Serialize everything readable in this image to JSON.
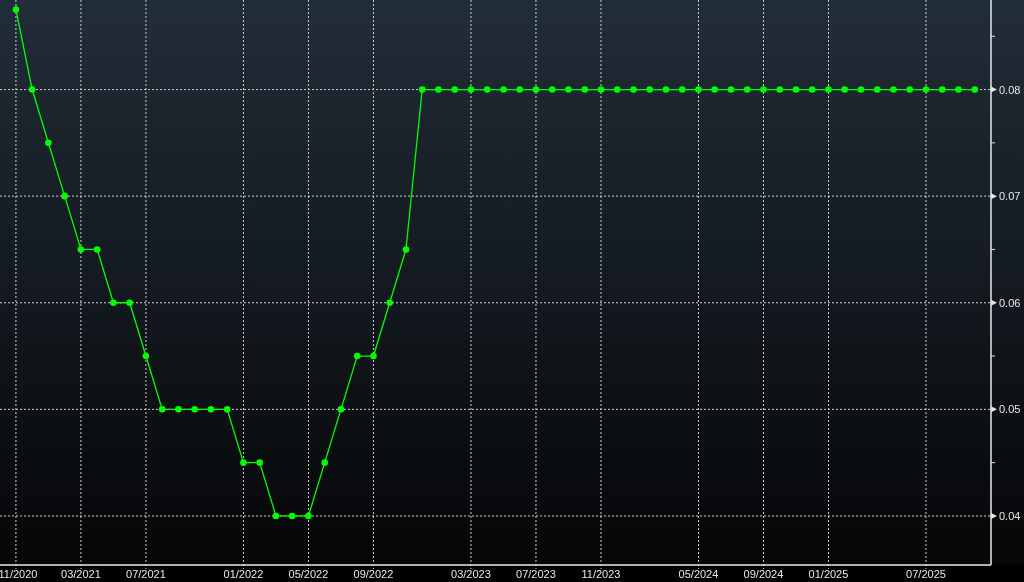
{
  "chart": {
    "chart_data": {
      "type": "line",
      "grid": true,
      "categories": [
        "11/2020",
        null,
        null,
        null,
        "03/2021",
        null,
        null,
        null,
        "07/2021",
        null,
        null,
        null,
        null,
        null,
        "01/2022",
        null,
        null,
        null,
        "05/2022",
        null,
        null,
        null,
        "09/2022",
        null,
        null,
        null,
        null,
        null,
        "03/2023",
        null,
        null,
        null,
        "07/2023",
        null,
        null,
        null,
        "11/2023",
        null,
        null,
        null,
        null,
        null,
        "05/2024",
        null,
        null,
        null,
        "09/2024",
        null,
        null,
        null,
        "01/2025",
        null,
        null,
        null,
        null,
        null,
        "07/2025",
        null,
        null,
        null
      ],
      "series": [
        {
          "color": "#00ff00",
          "marker": "circle",
          "values": [
            0.0875,
            0.08,
            0.075,
            0.07,
            0.065,
            0.065,
            0.06,
            0.06,
            0.055,
            0.05,
            0.05,
            0.05,
            0.05,
            0.05,
            0.045,
            0.045,
            0.04,
            0.04,
            0.04,
            0.045,
            0.05,
            0.055,
            0.055,
            0.06,
            0.065,
            0.08,
            0.08,
            0.08,
            0.08,
            0.08,
            0.08,
            0.08,
            0.08,
            0.08,
            0.08,
            0.08,
            0.08,
            0.08,
            0.08,
            0.08,
            0.08,
            0.08,
            0.08,
            0.08,
            0.08,
            0.08,
            0.08,
            0.08,
            0.08,
            0.08,
            0.08,
            0.08,
            0.08,
            0.08,
            0.08,
            0.08,
            0.08,
            0.08,
            0.08,
            0.08
          ]
        }
      ],
      "ylim": [
        0.0354,
        0.0884
      ],
      "yticks": [
        {
          "value": 0.04,
          "label": "0.04"
        },
        {
          "value": 0.05,
          "label": "0.05"
        },
        {
          "value": 0.06,
          "label": "0.06"
        },
        {
          "value": 0.07,
          "label": "0.07"
        },
        {
          "value": 0.08,
          "label": "0.08"
        }
      ]
    }
  }
}
